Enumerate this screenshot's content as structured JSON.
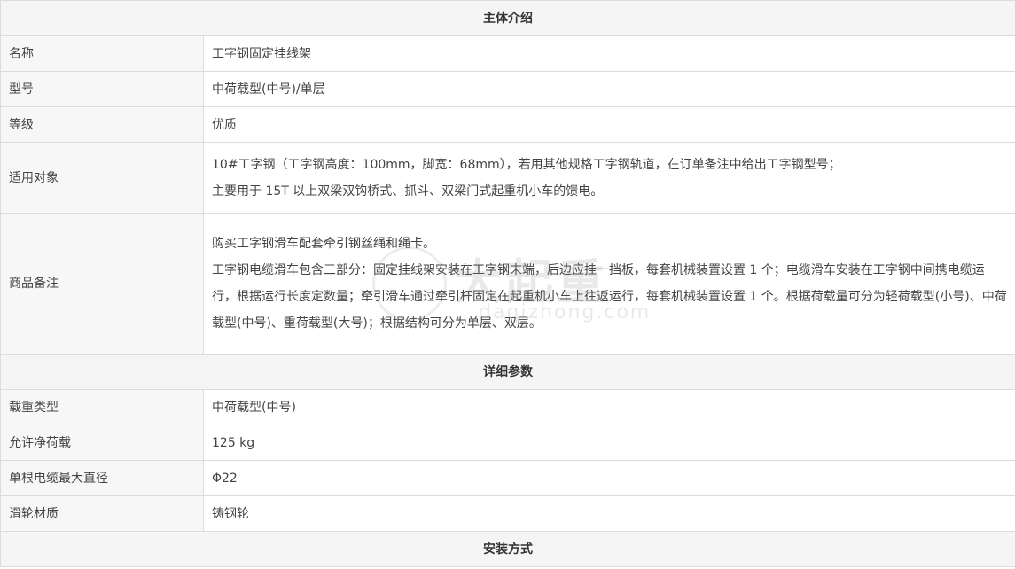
{
  "sections": {
    "intro": "主体介绍",
    "params": "详细参数",
    "install": "安装方式"
  },
  "intro_rows": {
    "name": {
      "label": "名称",
      "value": "工字钢固定挂线架"
    },
    "model": {
      "label": "型号",
      "value": "中荷载型(中号)/单层"
    },
    "grade": {
      "label": "等级",
      "value": "优质"
    },
    "target": {
      "label": "适用对象",
      "lines": [
        "10#工字钢（工字钢高度：100mm，脚宽：68mm），若用其他规格工字钢轨道，在订单备注中给出工字钢型号；",
        "主要用于 15T 以上双梁双钩桥式、抓斗、双梁门式起重机小车的馈电。"
      ]
    },
    "remarks": {
      "label": "商品备注",
      "lines": [
        "购买工字钢滑车配套牵引钢丝绳和绳卡。",
        "工字钢电缆滑车包含三部分：固定挂线架安装在工字钢末端，后边应挂一挡板，每套机械装置设置 1 个；电缆滑车安装在工字钢中间携电缆运行，根据运行长度定数量；牵引滑车通过牵引杆固定在起重机小车上往返运行，每套机械装置设置 1 个。根据荷载量可分为轻荷载型(小号)、中荷载型(中号)、重荷载型(大号)；根据结构可分为单层、双层。"
      ]
    }
  },
  "param_rows": {
    "load_type": {
      "label": "载重类型",
      "value": "中荷载型(中号)"
    },
    "net_load": {
      "label": "允许净荷载",
      "value": "125 kg"
    },
    "max_diameter": {
      "label": "单根电缆最大直径",
      "value": "Φ22"
    },
    "wheel_material": {
      "label": "滑轮材质",
      "value": "铸钢轮"
    }
  },
  "watermark": {
    "text": "大起重",
    "sub": "daqizhong.com"
  }
}
